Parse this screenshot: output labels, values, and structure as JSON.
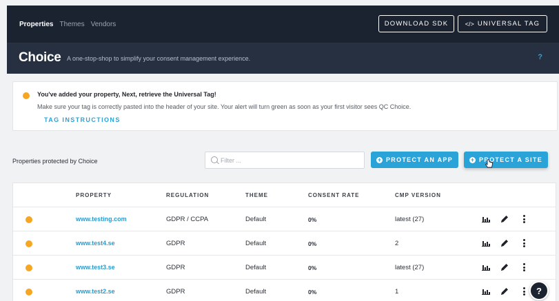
{
  "header": {
    "nav": [
      "Properties",
      "Themes",
      "Vendors"
    ],
    "download_sdk": "DOWNLOAD SDK",
    "universal_tag": "UNIVERSAL TAG",
    "brand": "Choice",
    "tagline": "A one-stop-shop to simplify your consent management experience.",
    "help": "?"
  },
  "alert": {
    "title": "You've added your property, Next, retrieve the Universal Tag!",
    "body": "Make sure your tag is correctly pasted into the header of your site. Your alert will turn green as soon as your first visitor sees QC Choice.",
    "link": "TAG INSTRUCTIONS"
  },
  "toolbar": {
    "label": "Properties protected by Choice",
    "filter_placeholder": "Filter ...",
    "protect_app": "PROTECT AN APP",
    "protect_site": "PROTECT A SITE"
  },
  "table": {
    "headers": [
      "PROPERTY",
      "REGULATION",
      "THEME",
      "CONSENT RATE",
      "CMP VERSION"
    ],
    "rows": [
      {
        "property": "www.testing.com",
        "regulation": "GDPR / CCPA",
        "theme": "Default",
        "consent_rate": "0%",
        "cmp_version": "latest (27)"
      },
      {
        "property": "www.test4.se",
        "regulation": "GDPR",
        "theme": "Default",
        "consent_rate": "0%",
        "cmp_version": "2"
      },
      {
        "property": "www.test3.se",
        "regulation": "GDPR",
        "theme": "Default",
        "consent_rate": "0%",
        "cmp_version": "latest (27)"
      },
      {
        "property": "www.test2.se",
        "regulation": "GDPR",
        "theme": "Default",
        "consent_rate": "0%",
        "cmp_version": "1"
      }
    ]
  },
  "help_fab": "?",
  "colors": {
    "accent": "#2aa3d8",
    "status_pending": "#f5a623",
    "header_bg": "#1c2330"
  }
}
